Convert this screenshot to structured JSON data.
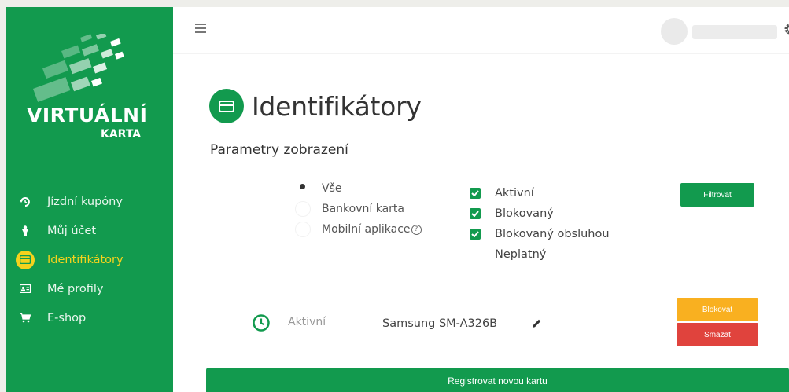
{
  "brand": {
    "title": "VIRTUÁLNÍ",
    "subtitle": "KARTA",
    "color": "#129a4e"
  },
  "sidebar": {
    "items": [
      {
        "label": "Jízdní kupóny",
        "icon": "ticket-icon",
        "active": false
      },
      {
        "label": "Můj účet",
        "icon": "person-icon",
        "active": false
      },
      {
        "label": "Identifikátory",
        "icon": "card-icon",
        "active": true
      },
      {
        "label": "Mé profily",
        "icon": "id-card-icon",
        "active": false
      },
      {
        "label": "E-shop",
        "icon": "cart-icon",
        "active": false
      }
    ],
    "active_color": "#f5d21d"
  },
  "header": {
    "menu_icon": "hamburger-icon",
    "settings_icon": "gear-icon"
  },
  "page": {
    "title": "Identifikátory",
    "title_icon": "card-icon"
  },
  "filters": {
    "section_title": "Parametry zobrazení",
    "radios": [
      {
        "label": "Vše",
        "checked": true
      },
      {
        "label": "Bankovní karta",
        "checked": false
      },
      {
        "label": "Mobilní aplikace",
        "checked": false,
        "help": "?"
      }
    ],
    "checkboxes": [
      {
        "label": "Aktivní",
        "checked": true
      },
      {
        "label": "Blokovaný",
        "checked": true
      },
      {
        "label": "Blokovaný obsluhou",
        "checked": true
      },
      {
        "label": "Neplatný",
        "checked": false
      }
    ],
    "filter_button": "Filtrovat"
  },
  "card": {
    "status": "Aktivní",
    "name": "Samsung SM-A326B",
    "block_button": "Blokovat",
    "delete_button": "Smazat"
  },
  "register_button": "Registrovat novou kartu",
  "colors": {
    "green": "#129a4e",
    "orange": "#f9b020",
    "red": "#e0433d",
    "yellow": "#f5d21d"
  }
}
